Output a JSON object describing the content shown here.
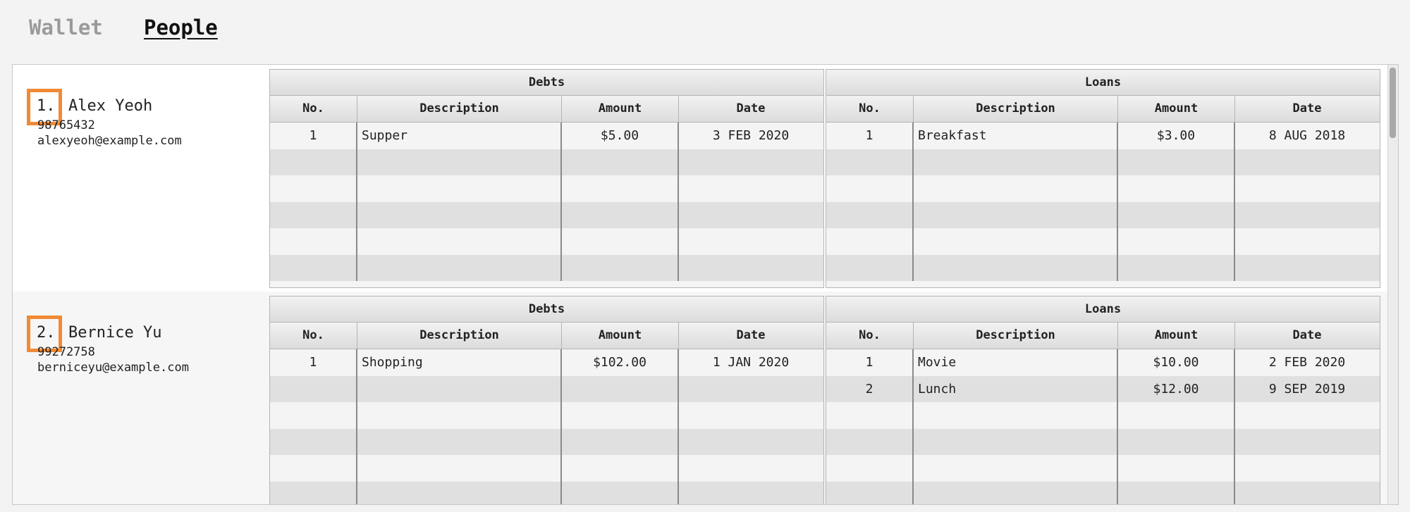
{
  "tabs": [
    {
      "label": "Wallet",
      "active": false
    },
    {
      "label": "People",
      "active": true
    }
  ],
  "accent_color": "#f08a34",
  "columns": {
    "no": "No.",
    "description": "Description",
    "amount": "Amount",
    "date": "Date"
  },
  "persons": [
    {
      "index": "1.",
      "name": "Alex Yeoh",
      "phone": "98765432",
      "email": "alexyeoh@example.com",
      "debts": {
        "title": "Debts",
        "rows": [
          {
            "no": "1",
            "description": "Supper",
            "amount": "$5.00",
            "date": "3 FEB 2020"
          }
        ]
      },
      "loans": {
        "title": "Loans",
        "rows": [
          {
            "no": "1",
            "description": "Breakfast",
            "amount": "$3.00",
            "date": "8 AUG 2018"
          }
        ]
      }
    },
    {
      "index": "2.",
      "name": "Bernice Yu",
      "phone": "99272758",
      "email": "berniceyu@example.com",
      "debts": {
        "title": "Debts",
        "rows": [
          {
            "no": "1",
            "description": "Shopping",
            "amount": "$102.00",
            "date": "1 JAN 2020"
          }
        ]
      },
      "loans": {
        "title": "Loans",
        "rows": [
          {
            "no": "1",
            "description": "Movie",
            "amount": "$10.00",
            "date": "2 FEB 2020"
          },
          {
            "no": "2",
            "description": "Lunch",
            "amount": "$12.00",
            "date": "9 SEP 2019"
          }
        ]
      }
    }
  ]
}
